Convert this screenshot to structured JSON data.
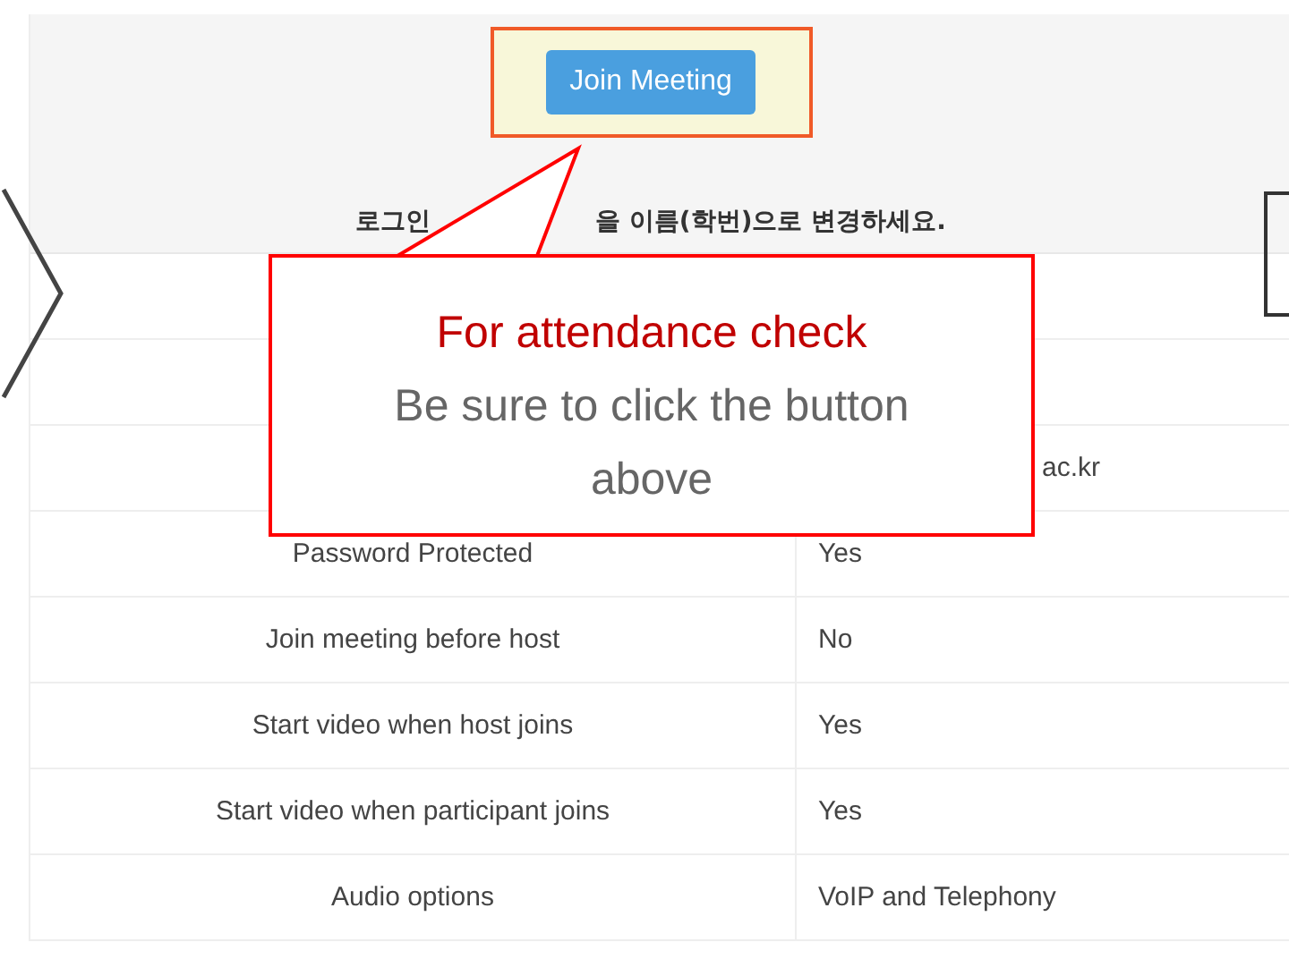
{
  "join_button": {
    "label": "Join Meeting"
  },
  "notice": {
    "before": "로그인",
    "after": "을 이름(학번)으로 변경하세요."
  },
  "rows": [
    {
      "label": "",
      "value": ""
    },
    {
      "label": "",
      "value": ""
    },
    {
      "label": "",
      "value": "ac.kr"
    },
    {
      "label": "Password Protected",
      "value": "Yes"
    },
    {
      "label": "Join meeting before host",
      "value": "No"
    },
    {
      "label": "Start video when host joins",
      "value": "Yes"
    },
    {
      "label": "Start video when participant joins",
      "value": "Yes"
    },
    {
      "label": "Audio options",
      "value": "VoIP and Telephony"
    }
  ],
  "callout": {
    "title": "For attendance check",
    "lines": [
      "Be sure to click the button",
      "above"
    ]
  }
}
